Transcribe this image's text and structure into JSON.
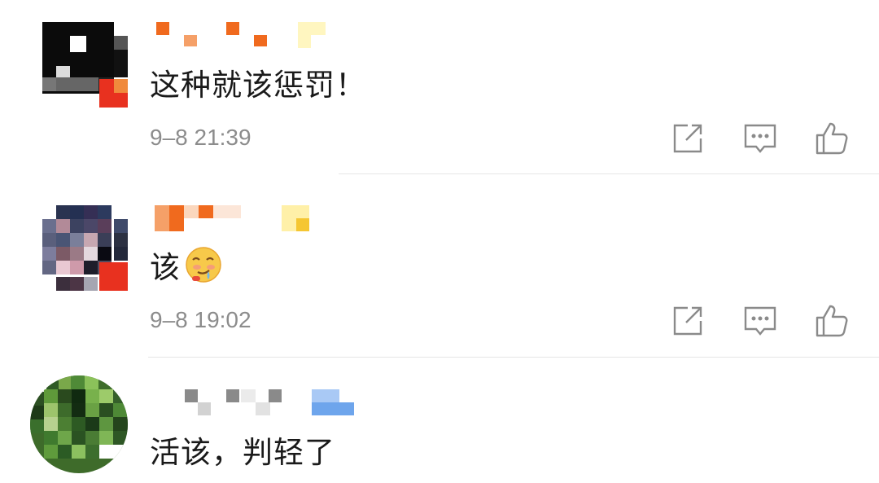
{
  "comments": [
    {
      "text": "这种就该惩罚！",
      "timestamp": "9–8 21:39",
      "emoji": null
    },
    {
      "text": "该",
      "timestamp": "9–8 19:02",
      "emoji": "drooling-emoji"
    },
    {
      "text": "活该，判轻了",
      "timestamp": "",
      "emoji": null
    }
  ],
  "actions": {
    "share_icon": "share-icon",
    "reply_icon": "comment-icon",
    "like_icon": "thumbs-up-icon"
  }
}
